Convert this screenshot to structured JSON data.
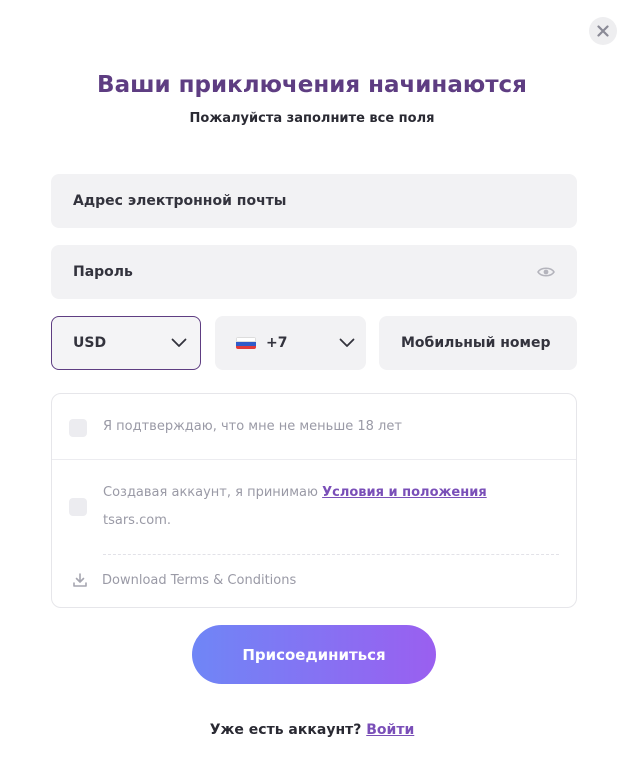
{
  "close": {
    "icon": "close-icon"
  },
  "header": {
    "title": "Ваши приключения начинаются",
    "subtitle": "Пожалуйста заполните все поля"
  },
  "form": {
    "email_placeholder": "Адрес электронной почты",
    "password_placeholder": "Пароль",
    "password_icon": "eye-icon",
    "currency": "USD",
    "phone_code": "+7",
    "phone_flag": "russia-flag",
    "mobile_placeholder": "Мобильный номер"
  },
  "consent": {
    "age_text": "Я подтверждаю, что мне не меньше 18 лет",
    "terms_prefix": "Создавая аккаунт, я принимаю",
    "terms_link": "Условия и положения",
    "terms_suffix": "tsars.com.",
    "download_text": "Download Terms & Conditions"
  },
  "actions": {
    "join_label": "Присоединиться",
    "login_prompt": "Уже есть аккаунт?",
    "login_link": "Войти"
  },
  "colors": {
    "accent": "#5e3d82",
    "link": "#7a4fb8",
    "button_start": "#6f86f6",
    "button_end": "#9a5ff0"
  }
}
